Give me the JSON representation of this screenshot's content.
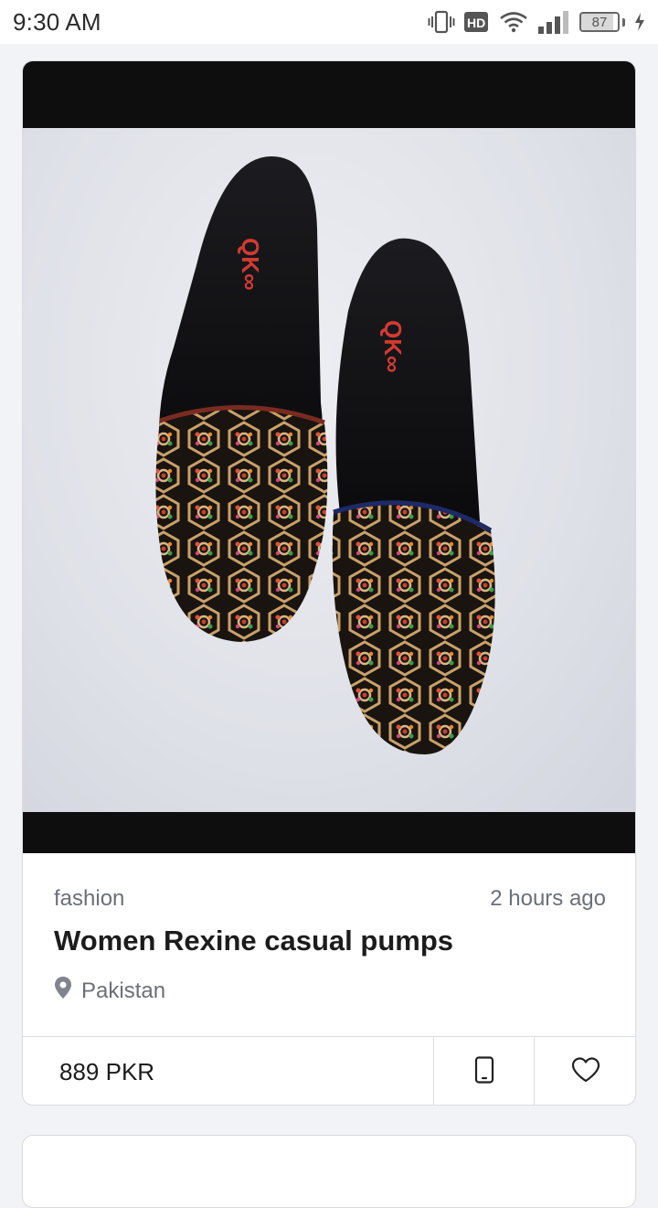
{
  "status_bar": {
    "time": "9:30 AM",
    "battery_level": "87",
    "network_label": "HD",
    "icons": [
      "vibrate-icon",
      "hd-icon",
      "wifi-icon",
      "signal-icon",
      "battery-icon",
      "charging-icon"
    ]
  },
  "listing": {
    "image_alt": "Embroidered black casual pumps",
    "category": "fashion",
    "time_ago": "2 hours ago",
    "title": "Women Rexine casual pumps",
    "location": "Pakistan",
    "price": "889 PKR",
    "icons": [
      "location-pin-icon",
      "phone-icon",
      "heart-icon"
    ]
  },
  "colors": {
    "accent_text": "#1c1c1c",
    "muted_text": "#6b6f78",
    "border": "#d9dbe0",
    "background": "#f2f3f7"
  }
}
